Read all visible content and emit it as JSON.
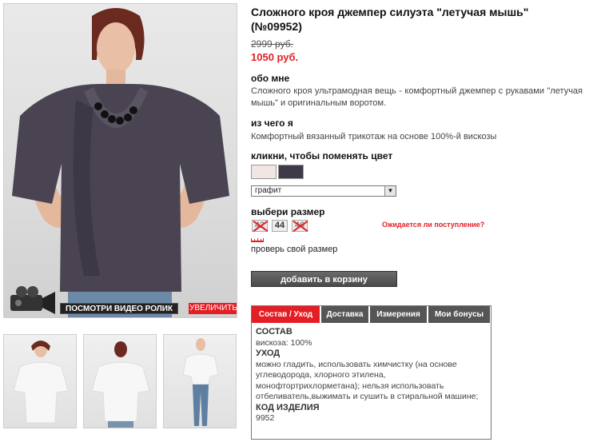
{
  "product": {
    "title": "Сложного кроя джемпер силуэта \"летучая мышь\" (№09952)",
    "old_price": "2999 руб.",
    "new_price": "1050 руб."
  },
  "about": {
    "heading": "обо мне",
    "text": "Сложного кроя ультрамодная вещь - комфортный джемпер с рукавами \"летучая мышь\" и оригинальным воротом."
  },
  "material": {
    "heading": "из чего я",
    "text": "Комфортный вязанный трикотаж на основе 100%-й вискозы"
  },
  "color": {
    "heading": "кликни, чтобы поменять цвет",
    "swatches": [
      "#f0e6e4",
      "#3f3a47"
    ],
    "selected": "графит"
  },
  "size": {
    "heading": "выбери размер",
    "options": [
      {
        "label": "42",
        "available": false
      },
      {
        "label": "44",
        "available": true
      },
      {
        "label": "46",
        "available": false
      }
    ],
    "expect_link": "Ожидается ли поступление?",
    "check_link": "проверь свой размер"
  },
  "cart_button": "добавить в корзину",
  "photo": {
    "video_label": "ПОСМОТРИ ВИДЕО РОЛИК",
    "zoom_label": "УВЕЛИЧИТЬ"
  },
  "tabs": {
    "items": [
      "Состав / Уход",
      "Доставка",
      "Измерения",
      "Мои бонусы"
    ],
    "content": {
      "composition_heading": "СОСТАВ",
      "composition": "вискоза: 100%",
      "care_heading": "УХОД",
      "care": "можно гладить, использовать химчистку (на основе углеводорода, хлорного этилена, монофтортрихлорметана); нельзя использовать отбеливатель,выжимать и сушить в стиральной машине;",
      "code_heading": "КОД ИЗДЕЛИЯ",
      "code": "9952"
    }
  },
  "colors": {
    "accent": "#e31e24",
    "garment": "#4a4452"
  }
}
